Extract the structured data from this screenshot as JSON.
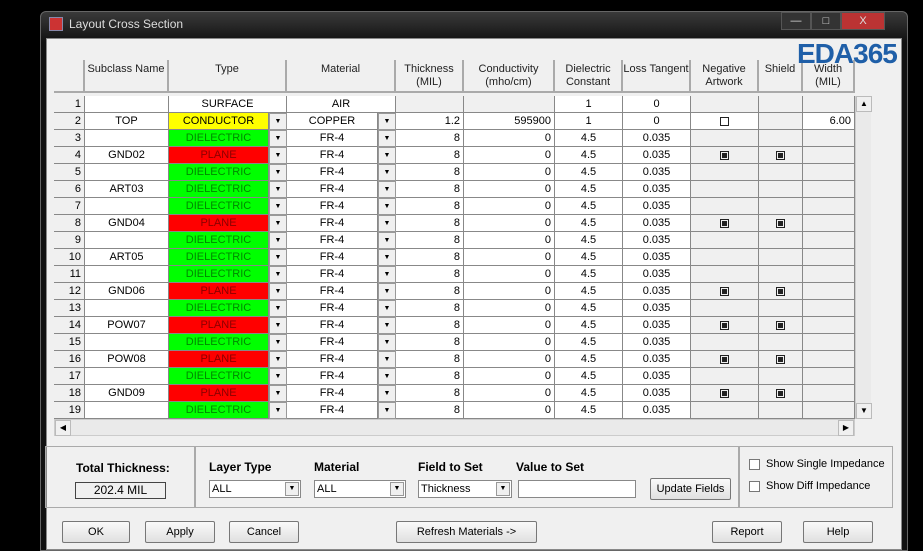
{
  "window": {
    "title": "Layout Cross Section",
    "minimize": "—",
    "maximize": "□",
    "close": "X"
  },
  "watermark": "EDA365",
  "columns": [
    "",
    "Subclass Name",
    "Type",
    "Material",
    "Thickness (MIL)",
    "Conductivity (mho/cm)",
    "Dielectric Constant",
    "Loss Tangent",
    "Negative Artwork",
    "Shield",
    "Width (MIL)"
  ],
  "rows": [
    {
      "n": "1",
      "name": "",
      "type": "SURFACE",
      "material": "AIR",
      "thickness": "",
      "cond": "",
      "dc": "1",
      "lt": "0",
      "neg": null,
      "shield": null,
      "width": "",
      "dropdown": false
    },
    {
      "n": "2",
      "name": "TOP",
      "type": "CONDUCTOR",
      "material": "COPPER",
      "thickness": "1.2",
      "cond": "595900",
      "dc": "1",
      "lt": "0",
      "neg": false,
      "shield": null,
      "width": "6.00",
      "dropdown": true
    },
    {
      "n": "3",
      "name": "",
      "type": "DIELECTRIC",
      "material": "FR-4",
      "thickness": "8",
      "cond": "0",
      "dc": "4.5",
      "lt": "0.035",
      "neg": null,
      "shield": null,
      "width": "",
      "dropdown": true
    },
    {
      "n": "4",
      "name": "GND02",
      "type": "PLANE",
      "material": "FR-4",
      "thickness": "8",
      "cond": "0",
      "dc": "4.5",
      "lt": "0.035",
      "neg": true,
      "shield": true,
      "width": "",
      "dropdown": true
    },
    {
      "n": "5",
      "name": "",
      "type": "DIELECTRIC",
      "material": "FR-4",
      "thickness": "8",
      "cond": "0",
      "dc": "4.5",
      "lt": "0.035",
      "neg": null,
      "shield": null,
      "width": "",
      "dropdown": true
    },
    {
      "n": "6",
      "name": "ART03",
      "type": "DIELECTRIC",
      "material": "FR-4",
      "thickness": "8",
      "cond": "0",
      "dc": "4.5",
      "lt": "0.035",
      "neg": null,
      "shield": null,
      "width": "",
      "dropdown": true
    },
    {
      "n": "7",
      "name": "",
      "type": "DIELECTRIC",
      "material": "FR-4",
      "thickness": "8",
      "cond": "0",
      "dc": "4.5",
      "lt": "0.035",
      "neg": null,
      "shield": null,
      "width": "",
      "dropdown": true
    },
    {
      "n": "8",
      "name": "GND04",
      "type": "PLANE",
      "material": "FR-4",
      "thickness": "8",
      "cond": "0",
      "dc": "4.5",
      "lt": "0.035",
      "neg": true,
      "shield": true,
      "width": "",
      "dropdown": true
    },
    {
      "n": "9",
      "name": "",
      "type": "DIELECTRIC",
      "material": "FR-4",
      "thickness": "8",
      "cond": "0",
      "dc": "4.5",
      "lt": "0.035",
      "neg": null,
      "shield": null,
      "width": "",
      "dropdown": true
    },
    {
      "n": "10",
      "name": "ART05",
      "type": "DIELECTRIC",
      "material": "FR-4",
      "thickness": "8",
      "cond": "0",
      "dc": "4.5",
      "lt": "0.035",
      "neg": null,
      "shield": null,
      "width": "",
      "dropdown": true
    },
    {
      "n": "11",
      "name": "",
      "type": "DIELECTRIC",
      "material": "FR-4",
      "thickness": "8",
      "cond": "0",
      "dc": "4.5",
      "lt": "0.035",
      "neg": null,
      "shield": null,
      "width": "",
      "dropdown": true
    },
    {
      "n": "12",
      "name": "GND06",
      "type": "PLANE",
      "material": "FR-4",
      "thickness": "8",
      "cond": "0",
      "dc": "4.5",
      "lt": "0.035",
      "neg": true,
      "shield": true,
      "width": "",
      "dropdown": true
    },
    {
      "n": "13",
      "name": "",
      "type": "DIELECTRIC",
      "material": "FR-4",
      "thickness": "8",
      "cond": "0",
      "dc": "4.5",
      "lt": "0.035",
      "neg": null,
      "shield": null,
      "width": "",
      "dropdown": true
    },
    {
      "n": "14",
      "name": "POW07",
      "type": "PLANE",
      "material": "FR-4",
      "thickness": "8",
      "cond": "0",
      "dc": "4.5",
      "lt": "0.035",
      "neg": true,
      "shield": true,
      "width": "",
      "dropdown": true
    },
    {
      "n": "15",
      "name": "",
      "type": "DIELECTRIC",
      "material": "FR-4",
      "thickness": "8",
      "cond": "0",
      "dc": "4.5",
      "lt": "0.035",
      "neg": null,
      "shield": null,
      "width": "",
      "dropdown": true
    },
    {
      "n": "16",
      "name": "POW08",
      "type": "PLANE",
      "material": "FR-4",
      "thickness": "8",
      "cond": "0",
      "dc": "4.5",
      "lt": "0.035",
      "neg": true,
      "shield": true,
      "width": "",
      "dropdown": true
    },
    {
      "n": "17",
      "name": "",
      "type": "DIELECTRIC",
      "material": "FR-4",
      "thickness": "8",
      "cond": "0",
      "dc": "4.5",
      "lt": "0.035",
      "neg": null,
      "shield": null,
      "width": "",
      "dropdown": true
    },
    {
      "n": "18",
      "name": "GND09",
      "type": "PLANE",
      "material": "FR-4",
      "thickness": "8",
      "cond": "0",
      "dc": "4.5",
      "lt": "0.035",
      "neg": true,
      "shield": true,
      "width": "",
      "dropdown": true
    },
    {
      "n": "19",
      "name": "",
      "type": "DIELECTRIC",
      "material": "FR-4",
      "thickness": "8",
      "cond": "0",
      "dc": "4.5",
      "lt": "0.035",
      "neg": null,
      "shield": null,
      "width": "",
      "dropdown": true
    }
  ],
  "type_colors": {
    "SURFACE": "#ffffff",
    "CONDUCTOR": "#ffff00",
    "DIELECTRIC": "#00ff00",
    "PLANE": "#ff0000"
  },
  "type_text_colors": {
    "SURFACE": "#000000",
    "CONDUCTOR": "#000000",
    "DIELECTRIC": "#008800",
    "PLANE": "#8b0000"
  },
  "total": {
    "label": "Total Thickness:",
    "value": "202.4 MIL"
  },
  "filters": {
    "layer_type_label": "Layer Type",
    "layer_type": "ALL",
    "material_label": "Material",
    "material": "ALL",
    "field_label": "Field to Set",
    "field": "Thickness",
    "value_label": "Value to Set",
    "value": "",
    "update": "Update Fields"
  },
  "options": {
    "single": "Show Single Impedance",
    "diff": "Show Diff Impedance"
  },
  "buttons": {
    "ok": "OK",
    "apply": "Apply",
    "cancel": "Cancel",
    "refresh": "Refresh Materials ->",
    "report": "Report",
    "help": "Help"
  }
}
